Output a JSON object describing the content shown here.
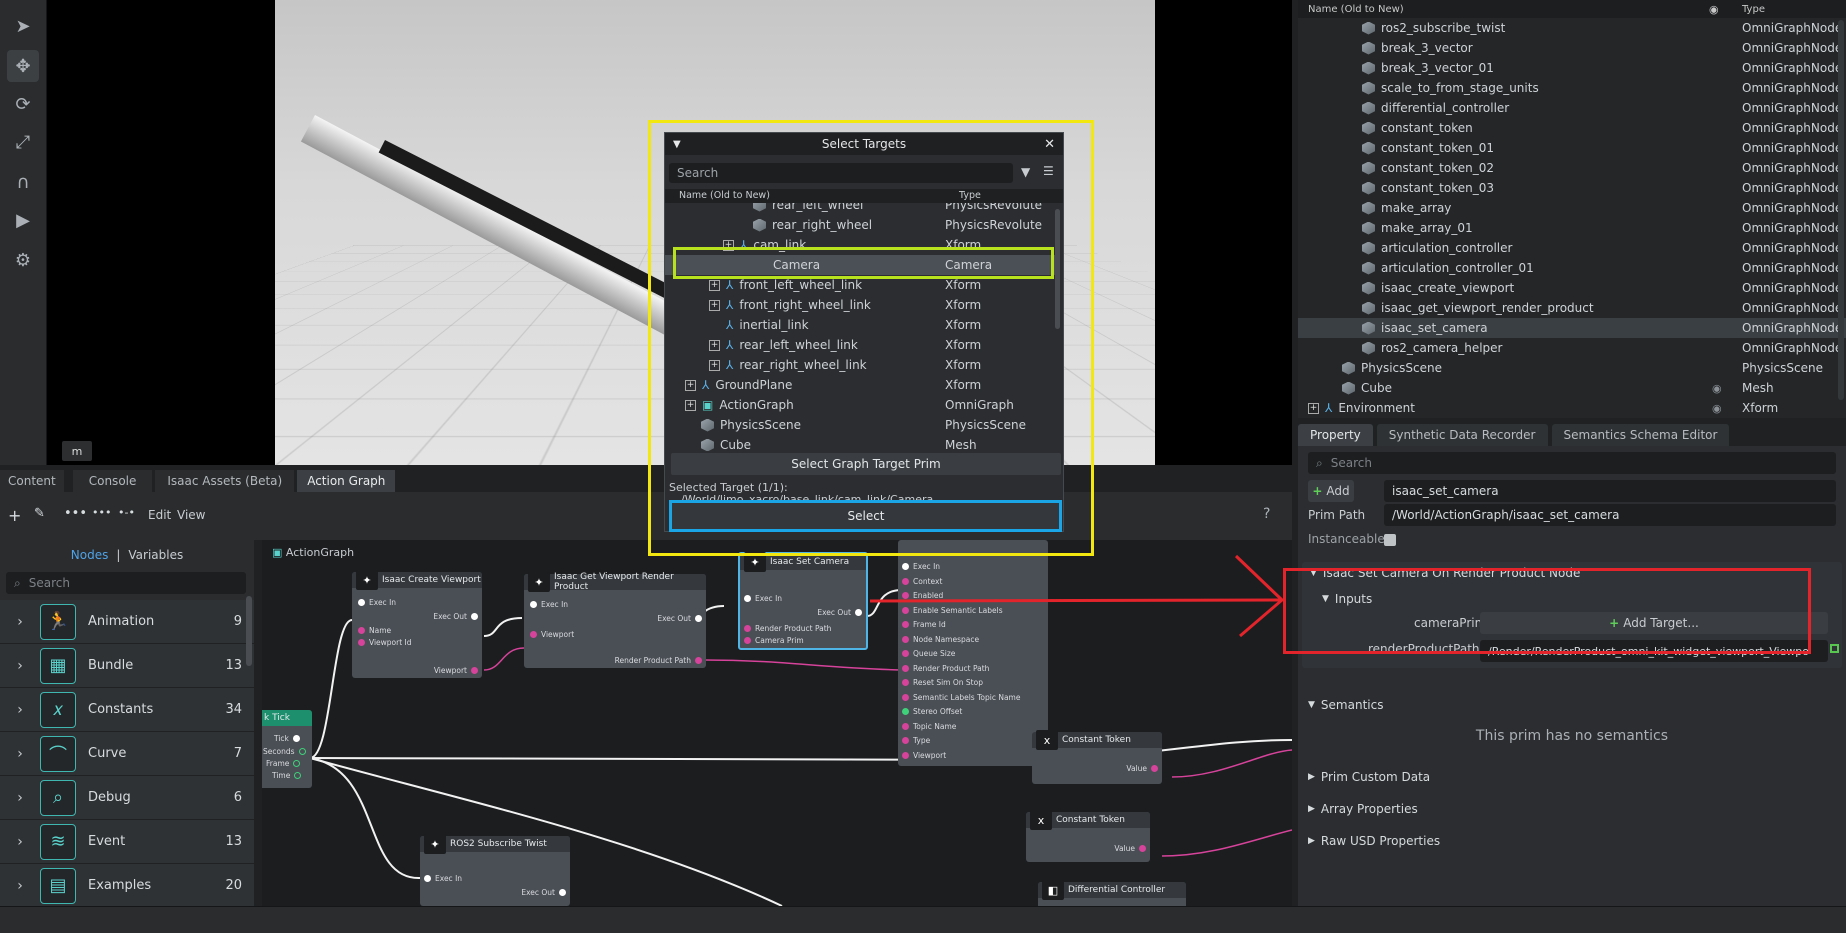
{
  "toolbar": {
    "icons": [
      "select-arrow-icon",
      "move-icon",
      "rotate-icon",
      "scale-icon",
      "snap-magnet-icon",
      "play-icon",
      "settings-icon"
    ]
  },
  "viewport": {
    "badge": "m"
  },
  "stage": {
    "header": {
      "name": "Name (Old to New)",
      "type": "Type"
    },
    "rows": [
      {
        "name": "ros2_subscribe_twist",
        "type": "OmniGraphNode"
      },
      {
        "name": "break_3_vector",
        "type": "OmniGraphNode"
      },
      {
        "name": "break_3_vector_01",
        "type": "OmniGraphNode"
      },
      {
        "name": "scale_to_from_stage_units",
        "type": "OmniGraphNode"
      },
      {
        "name": "differential_controller",
        "type": "OmniGraphNode"
      },
      {
        "name": "constant_token",
        "type": "OmniGraphNode"
      },
      {
        "name": "constant_token_01",
        "type": "OmniGraphNode"
      },
      {
        "name": "constant_token_02",
        "type": "OmniGraphNode"
      },
      {
        "name": "constant_token_03",
        "type": "OmniGraphNode"
      },
      {
        "name": "make_array",
        "type": "OmniGraphNode"
      },
      {
        "name": "make_array_01",
        "type": "OmniGraphNode"
      },
      {
        "name": "articulation_controller",
        "type": "OmniGraphNode"
      },
      {
        "name": "articulation_controller_01",
        "type": "OmniGraphNode"
      },
      {
        "name": "isaac_create_viewport",
        "type": "OmniGraphNode"
      },
      {
        "name": "isaac_get_viewport_render_product",
        "type": "OmniGraphNode"
      },
      {
        "name": "isaac_set_camera",
        "type": "OmniGraphNode"
      },
      {
        "name": "ros2_camera_helper",
        "type": "OmniGraphNode"
      },
      {
        "name": "PhysicsScene",
        "type": "PhysicsScene"
      },
      {
        "name": "Cube",
        "type": "Mesh"
      },
      {
        "name": "Environment",
        "type": "Xform"
      }
    ]
  },
  "property": {
    "tabs": [
      "Property",
      "Synthetic Data Recorder",
      "Semantics Schema Editor"
    ],
    "search_placeholder": "Search",
    "add_label": "Add",
    "name_value": "isaac_set_camera",
    "prim_path_label": "Prim Path",
    "prim_path_value": "/World/ActionGraph/isaac_set_camera",
    "instanceable_label": "Instanceable",
    "node_section": "Isaac Set Camera On Render Product Node",
    "inputs_section": "Inputs",
    "camera_prim_label": "cameraPrim",
    "add_target_label": "Add Target...",
    "render_product_label": "renderProductPath",
    "render_product_value": "/Render/RenderProduct_omni_kit_widget_viewport_Viewpo",
    "semantics_section": "Semantics",
    "no_semantics": "This prim has no semantics",
    "prim_custom_data": "Prim Custom Data",
    "array_properties": "Array Properties",
    "raw_usd": "Raw USD Properties"
  },
  "bottom_tabs": [
    "Content",
    "Console",
    "Isaac Assets (Beta)",
    "Action Graph"
  ],
  "graph_toolbar": {
    "edit": "Edit",
    "view": "View",
    "help": "?"
  },
  "left_panel": {
    "nodes_tab": "Nodes",
    "separator": "|",
    "variables_tab": "Variables",
    "search_placeholder": "Search",
    "categories": [
      {
        "label": "Animation",
        "count": "9",
        "icon": "running-person-icon"
      },
      {
        "label": "Bundle",
        "count": "13",
        "icon": "box-icon"
      },
      {
        "label": "Constants",
        "count": "34",
        "icon": "x-variable-icon"
      },
      {
        "label": "Curve",
        "count": "7",
        "icon": "curve-icon"
      },
      {
        "label": "Debug",
        "count": "6",
        "icon": "debug-magnifier-icon"
      },
      {
        "label": "Event",
        "count": "13",
        "icon": "wifi-event-icon"
      },
      {
        "label": "Examples",
        "count": "20",
        "icon": "examples-icon"
      }
    ]
  },
  "graph": {
    "title": "ActionGraph",
    "nodes": {
      "tick": {
        "title": "k Tick",
        "pins": [
          "Tick",
          "a Seconds",
          "Frame",
          "Time"
        ]
      },
      "create_viewport": {
        "title": "Isaac Create Viewport",
        "pins": [
          "Exec In",
          "Exec Out",
          "Name",
          "Viewport Id",
          "Viewport"
        ]
      },
      "get_rp": {
        "title": "Isaac Get Viewport Render Product",
        "pins": [
          "Exec In",
          "Exec Out",
          "Viewport",
          "Render Product Path"
        ]
      },
      "set_camera": {
        "title": "Isaac Set Camera",
        "pins": [
          "Exec In",
          "Exec Out",
          "Render Product Path",
          "Camera Prim"
        ]
      },
      "camera_helper": {
        "pins": [
          "Exec In",
          "Context",
          "Enabled",
          "Enable Semantic Labels",
          "Frame Id",
          "Node Namespace",
          "Queue Size",
          "Render Product Path",
          "Reset Sim On Stop",
          "Semantic Labels Topic Name",
          "Stereo Offset",
          "Topic Name",
          "Type",
          "Viewport"
        ]
      },
      "subscribe_twist": {
        "title": "ROS2 Subscribe Twist",
        "pins": [
          "Exec In",
          "Exec Out"
        ]
      },
      "const_token_1": {
        "title": "Constant Token",
        "pins": [
          "Value"
        ]
      },
      "const_token_2": {
        "title": "Constant Token",
        "pins": [
          "Value"
        ]
      },
      "diff_controller": {
        "title": "Differential Controller"
      }
    }
  },
  "dialog": {
    "title": "Select Targets",
    "search_placeholder": "Search",
    "header_name": "Name (Old to New)",
    "header_type": "Type",
    "rows": [
      {
        "name": "rear_left_wheel",
        "type": "PhysicsRevolute"
      },
      {
        "name": "rear_right_wheel",
        "type": "PhysicsRevolute"
      },
      {
        "name": "cam_link",
        "type": "Xform"
      },
      {
        "name": "Camera",
        "type": "Camera"
      },
      {
        "name": "front_left_wheel_link",
        "type": "Xform"
      },
      {
        "name": "front_right_wheel_link",
        "type": "Xform"
      },
      {
        "name": "inertial_link",
        "type": "Xform"
      },
      {
        "name": "rear_left_wheel_link",
        "type": "Xform"
      },
      {
        "name": "rear_right_wheel_link",
        "type": "Xform"
      },
      {
        "name": "GroundPlane",
        "type": "Xform"
      },
      {
        "name": "ActionGraph",
        "type": "OmniGraph"
      },
      {
        "name": "PhysicsScene",
        "type": "PhysicsScene"
      },
      {
        "name": "Cube",
        "type": "Mesh"
      }
    ],
    "target_button": "Select Graph Target Prim",
    "selected_label": "Selected Target (1/1):",
    "selected_path": "/World/limo_xacro/base_link/cam_link/Camera",
    "select_button": "Select"
  },
  "colors": {
    "yellow_highlight": "#f2e70f",
    "green_highlight": "#b7e21d",
    "blue_highlight": "#1aa6e6",
    "red_highlight": "#e3242b",
    "exec_white": "#ffffff",
    "pin_magenta": "#d6439a",
    "pin_green": "#3ed17a"
  }
}
